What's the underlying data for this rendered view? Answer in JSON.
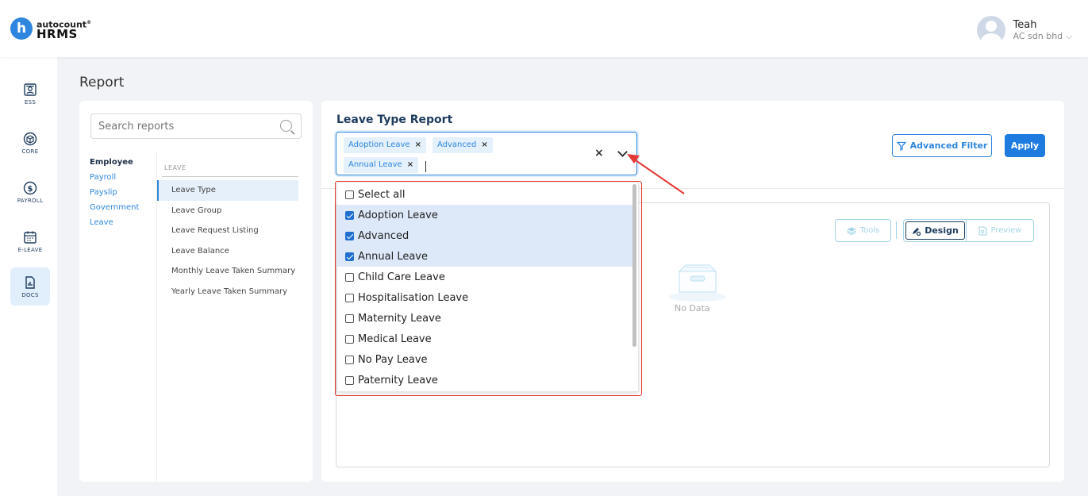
{
  "header": {
    "logo_letter": "h",
    "logo_top": "autocount",
    "logo_sup": "®",
    "logo_bottom": "HRMS",
    "user_name": "Teah",
    "user_company": "AC sdn bhd ⌵"
  },
  "sidenav": {
    "items": [
      {
        "label": "ESS",
        "icon": "ess-icon"
      },
      {
        "label": "CORE",
        "icon": "core-icon"
      },
      {
        "label": "PAYROLL",
        "icon": "payroll-icon"
      },
      {
        "label": "E-LEAVE",
        "icon": "eleave-icon"
      },
      {
        "label": "DOCS",
        "icon": "docs-icon"
      }
    ],
    "active": "DOCS"
  },
  "page": {
    "title": "Report"
  },
  "left_panel": {
    "search_placeholder": "Search reports",
    "categories": [
      "Employee",
      "Payroll",
      "Payslip",
      "Government",
      "Leave"
    ],
    "active_category": "Employee",
    "sub_header": "LEAVE",
    "sub_items": [
      "Leave Type",
      "Leave Group",
      "Leave Request Listing",
      "Leave Balance",
      "Monthly Leave Taken Summary",
      "Yearly Leave Taken Summary"
    ],
    "active_sub": "Leave Type"
  },
  "main": {
    "title": "Leave Type Report",
    "selected_tags": [
      "Adoption Leave",
      "Advanced",
      "Annual Leave"
    ],
    "tag_remove": "×",
    "clear": "×",
    "advanced_filter_label": "Advanced Filter",
    "apply_label": "Apply",
    "tools_label": "Tools",
    "design_label": "Design",
    "preview_label": "Preview",
    "no_data": "No Data"
  },
  "dropdown": {
    "options": [
      {
        "label": "Select all",
        "checked": false
      },
      {
        "label": "Adoption Leave",
        "checked": true
      },
      {
        "label": "Advanced",
        "checked": true
      },
      {
        "label": "Annual Leave",
        "checked": true
      },
      {
        "label": "Child Care Leave",
        "checked": false
      },
      {
        "label": "Hospitalisation Leave",
        "checked": false
      },
      {
        "label": "Maternity Leave",
        "checked": false
      },
      {
        "label": "Medical Leave",
        "checked": false
      },
      {
        "label": "No Pay Leave",
        "checked": false
      },
      {
        "label": "Paternity Leave",
        "checked": false
      }
    ]
  },
  "colors": {
    "accent": "#2e86de",
    "annotation": "#e53935",
    "selected_row": "#dde9f9"
  }
}
